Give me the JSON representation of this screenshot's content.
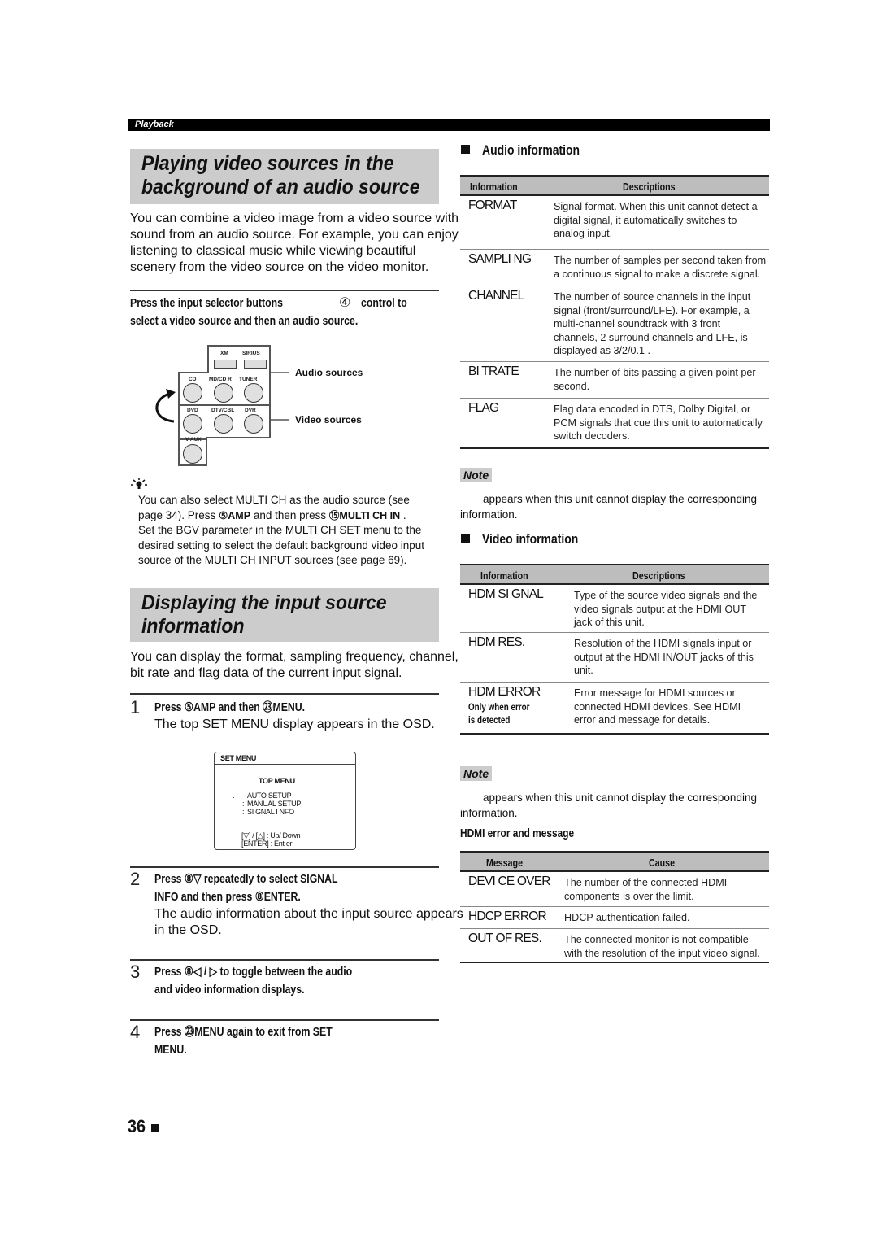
{
  "header": {
    "section_label": "Playback"
  },
  "left": {
    "section1": {
      "title_line1": "Playing video sources in the",
      "title_line2": "background of an audio source",
      "intro": [
        "You can combine a video image from a video source with",
        "sound from an audio source. For example, you can enjoy",
        "listening to classical music while viewing beautiful",
        "scenery from the video source on the video monitor."
      ],
      "instruction": {
        "line1_a": "Press the input selector buttons",
        "line1_num": "④",
        "line1_b": "control to",
        "line2": "select a video source and then an audio source."
      },
      "diagram": {
        "top_buttons": [
          "XM",
          "SIRIUS"
        ],
        "audio_buttons": [
          "CD",
          "MD/CD R",
          "TUNER"
        ],
        "video_buttons": [
          "DVD",
          "DTV/CBL",
          "DVR"
        ],
        "extra_button": "V AUX",
        "audio_label": "Audio sources",
        "video_label": "Video sources"
      },
      "tip": {
        "icon": "lightbulb-icon",
        "lines": [
          "You can also select  MULTI CH  as the audio source (see",
          "page 34). Press",
          "and then press",
          "Set the  BGV  parameter in the  MULTI CH SET  menu to the",
          "desired setting to select the default background video input",
          "source of the MULTI CH INPUT sources (see page 69)."
        ],
        "amp_key": "⑤AMP",
        "multi_key": "⑮MULTI CH IN"
      }
    },
    "section2": {
      "title_line1": "Displaying the input source",
      "title_line2": "information",
      "intro": [
        "You can display the format, sampling frequency, channel,",
        "bit rate and flag data of the current input signal."
      ],
      "steps": [
        {
          "num": "1",
          "head_lines": [
            "Press  ⑤AMP and then   ㉓MENU."
          ],
          "body_lines": [
            "The top  SET MENU  display appears in the OSD."
          ]
        },
        {
          "num": "2",
          "head_lines": [
            "Press  ⑧▽ repeatedly to select SIGNAL",
            "INFO and then press       ⑧ENTER."
          ],
          "body_lines": [
            "The audio information about the input source appears",
            "in the OSD."
          ]
        },
        {
          "num": "3",
          "head_lines": [
            "Press  ⑧◁ / ▷ to toggle between the audio",
            "and video information displays."
          ],
          "body_lines": []
        },
        {
          "num": "4",
          "head_lines": [
            "Press  ㉓MENU again to exit from SET",
            "MENU."
          ],
          "body_lines": []
        }
      ],
      "osd": {
        "title": "SET  MENU",
        "heading": "TOP  MENU",
        "items": [
          "AUTO SETUP",
          "MANUAL  SETUP",
          "SI GNAL  I NFO"
        ],
        "hint1": "[▽] / [△] : Up/ Down",
        "hint2": "[ENTER] : Ent er"
      }
    }
  },
  "right": {
    "audio_info": {
      "title": "Audio information",
      "col1": "Information",
      "col2": "Descriptions",
      "rows": [
        {
          "key": "FORMAT",
          "desc": [
            "Signal format. When this unit cannot detect a",
            "digital signal, it automatically switches to",
            "analog input."
          ]
        },
        {
          "key": "SAMPLI NG",
          "desc": [
            "The number of samples per second taken from",
            "a continuous signal to make a discrete signal."
          ]
        },
        {
          "key": "CHANNEL",
          "desc": [
            "The number of source channels in the input",
            "signal (front/surround/LFE). For example, a",
            "multi-channel soundtrack with 3 front",
            "channels, 2 surround channels and LFE, is",
            "displayed as  3/2/0.1 ."
          ]
        },
        {
          "key": "BI TRATE",
          "desc": [
            "The number of bits passing a given point per",
            "second."
          ]
        },
        {
          "key": "FLAG",
          "desc": [
            "Flag data encoded in DTS, Dolby Digital, or",
            "PCM signals that cue this unit to automatically",
            "switch decoders."
          ]
        }
      ]
    },
    "note1": {
      "label": "Note",
      "lines": [
        "appears when this unit cannot display the corresponding",
        "information."
      ]
    },
    "video_info": {
      "title": "Video information",
      "col1": "Information",
      "col2": "Descriptions",
      "rows": [
        {
          "key": "HDM   SI GNAL",
          "desc": [
            "Type of the source video signals and the",
            "video signals output at the HDMI OUT",
            "jack of this unit."
          ]
        },
        {
          "key": "HDM   RES.",
          "desc": [
            "Resolution of the HDMI signals input or",
            "output at the HDMI IN/OUT jacks of this",
            "unit."
          ]
        },
        {
          "key": "HDM   ERROR",
          "sub": [
            "Only  when error",
            "is detected"
          ],
          "desc": [
            "Error message for HDMI sources or",
            "connected HDMI devices. See  HDMI",
            "error and message  for details."
          ]
        }
      ]
    },
    "note2": {
      "label": "Note",
      "lines": [
        "appears when this unit cannot display the corresponding",
        "information."
      ]
    },
    "hdmi_errors": {
      "title": "HDMI error and message",
      "col1": "Message",
      "col2": "Cause",
      "rows": [
        {
          "key": "DEVI CE  OVER",
          "desc": [
            "The number of the connected HDMI",
            "components is over the limit."
          ]
        },
        {
          "key": "HDCP  ERROR",
          "desc": [
            "HDCP authentication failed."
          ]
        },
        {
          "key": "OUT  OF  RES.",
          "desc": [
            "The connected monitor is not compatible",
            "with the resolution of the input video signal."
          ]
        }
      ]
    }
  },
  "footer": {
    "page_number": "36"
  }
}
